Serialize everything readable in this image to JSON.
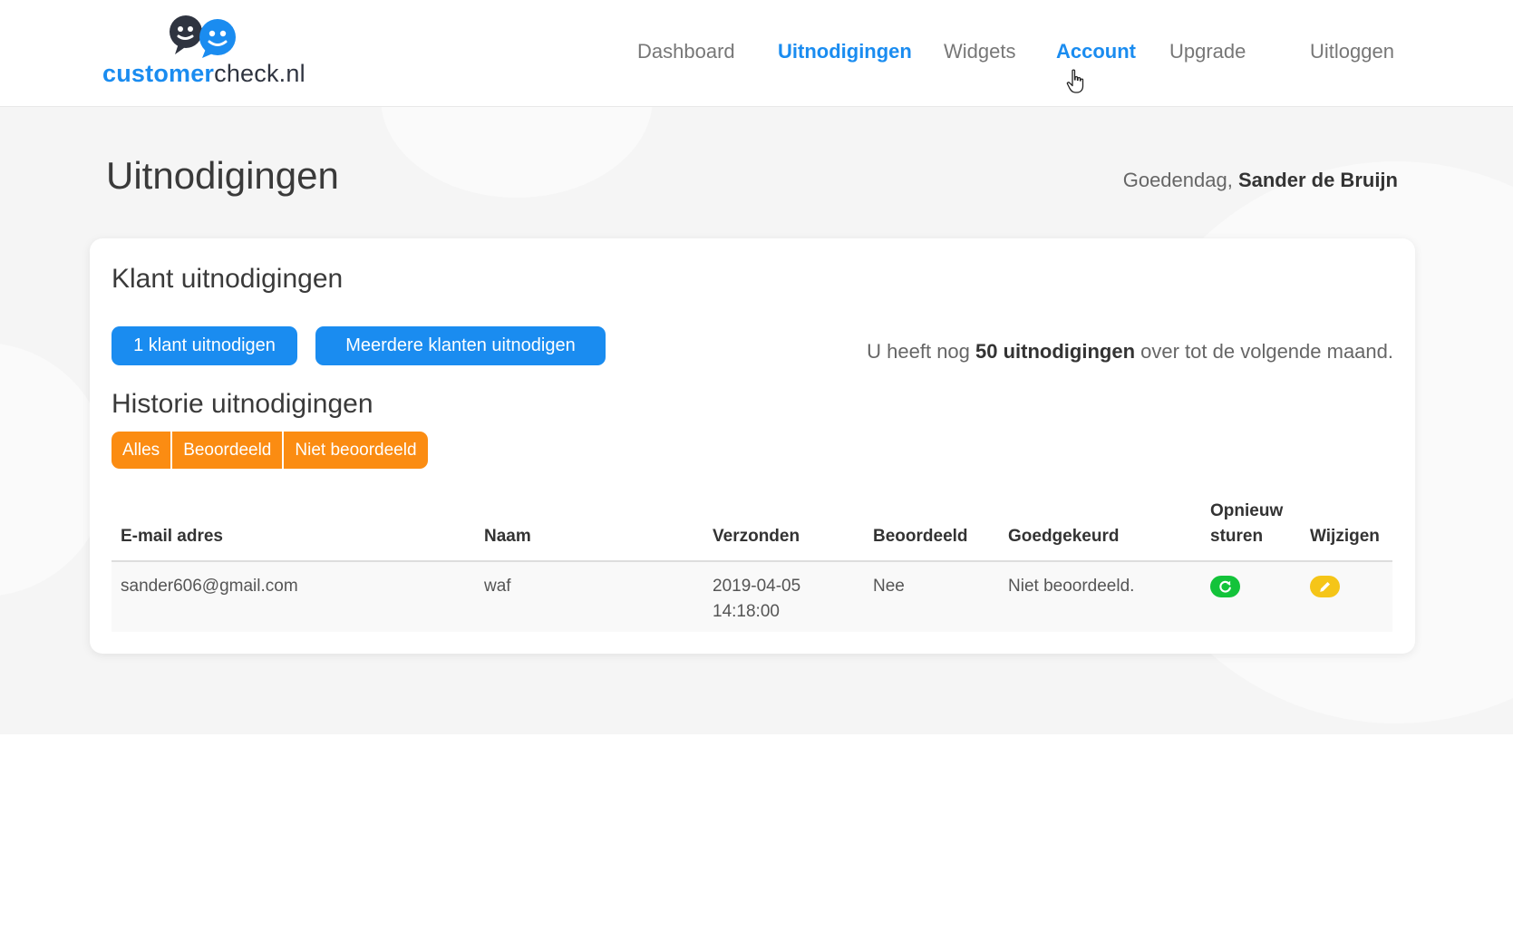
{
  "brand": {
    "part1": "customer",
    "part2": "check.nl"
  },
  "nav": {
    "dashboard": "Dashboard",
    "invitations": "Uitnodigingen",
    "widgets": "Widgets",
    "account": "Account",
    "upgrade": "Upgrade",
    "logout": "Uitloggen"
  },
  "page": {
    "title": "Uitnodigingen",
    "greeting": "Goedendag,",
    "user_name": "Sander de Bruijn"
  },
  "card": {
    "title": "Klant uitnodigingen",
    "invite_one": "1 klant uitnodigen",
    "invite_many": "Meerdere klanten uitnodigen",
    "quota_pre": "U heeft nog ",
    "quota_bold": "50 uitnodigingen",
    "quota_post": " over tot de volgende maand.",
    "history_title": "Historie uitnodigingen",
    "filters": {
      "all": "Alles",
      "rated": "Beoordeeld",
      "not_rated": "Niet beoordeeld"
    }
  },
  "table": {
    "headers": {
      "email": "E-mail adres",
      "name": "Naam",
      "sent": "Verzonden",
      "rated": "Beoordeeld",
      "approved": "Goedgekeurd",
      "resend_1": "Opnieuw",
      "resend_2": "sturen",
      "edit": "Wijzigen"
    },
    "rows": [
      {
        "email": "sander606@gmail.com",
        "name": "waf",
        "sent_date": "2019-04-05",
        "sent_time": "14:18:00",
        "rated": "Nee",
        "approved": "Niet beoordeeld."
      }
    ]
  },
  "colors": {
    "primary_blue": "#1a8cf0",
    "orange": "#fb8c12",
    "green": "#13c33a",
    "yellow": "#f5c518"
  },
  "icons": {
    "logo": "speech-bubbles-faces-icon",
    "resend": "refresh-icon",
    "edit": "pencil-icon",
    "cursor": "hand-pointer-icon"
  }
}
